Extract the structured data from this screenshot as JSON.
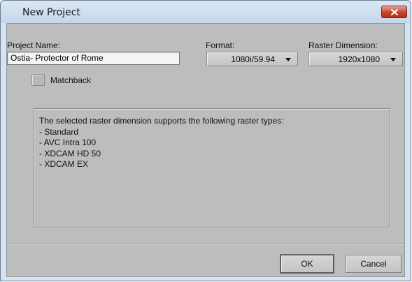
{
  "window": {
    "title": "New Project",
    "close_icon": "close-x-icon"
  },
  "form": {
    "project_name_label": "Project Name:",
    "project_name_value": "Ostia- Protector of Rome",
    "format_label": "Format:",
    "format_value": "1080i/59.94",
    "raster_label": "Raster Dimension:",
    "raster_value": "1920x1080",
    "matchback_label": "Matchback"
  },
  "info": {
    "heading": "The selected raster dimension supports the following raster types:",
    "items": [
      " - Standard",
      " - AVC Intra 100",
      " - XDCAM HD 50",
      " - XDCAM EX"
    ]
  },
  "buttons": {
    "ok": "OK",
    "cancel": "Cancel"
  },
  "colors": {
    "title_bar": "#c6d7ec",
    "close_button": "#c7442a",
    "panel": "#bdbdbd"
  }
}
